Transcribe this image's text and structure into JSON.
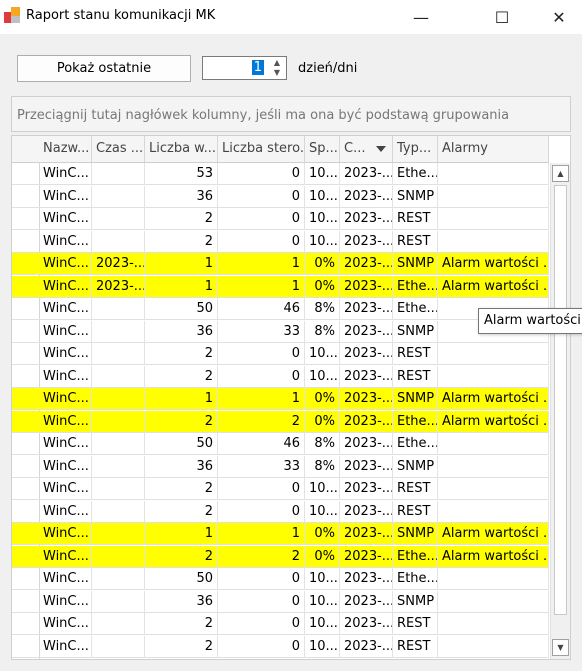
{
  "window": {
    "title": "Raport stanu komunikacji MK",
    "minimize_glyph": "—",
    "maximize_glyph": "☐",
    "close_glyph": "✕"
  },
  "toolbar": {
    "show_button_label": "Pokaż ostatnie",
    "days_value": "1",
    "days_label": "dzień/dni"
  },
  "group_panel": {
    "hint": "Przeciągnij tutaj nagłówek kolumny, jeśli ma ona być podstawą grupowania"
  },
  "grid": {
    "columns": [
      "Nazw...",
      "Czas ...",
      "Liczba w...",
      "Liczba stero...",
      "Sp...",
      "C...",
      "Typ...",
      "Alarmy"
    ],
    "sorted_column": "C...",
    "highlight_color": "#ffff00",
    "rows": [
      {
        "c": [
          "WinC...",
          "",
          "53",
          "0",
          "10...",
          "2023-...",
          "Ethe...",
          ""
        ],
        "hl": false
      },
      {
        "c": [
          "WinC...",
          "",
          "36",
          "0",
          "10...",
          "2023-...",
          "SNMP",
          ""
        ],
        "hl": false
      },
      {
        "c": [
          "WinC...",
          "",
          "2",
          "0",
          "10...",
          "2023-...",
          "REST",
          ""
        ],
        "hl": false
      },
      {
        "c": [
          "WinC...",
          "",
          "2",
          "0",
          "10...",
          "2023-...",
          "REST",
          ""
        ],
        "hl": false
      },
      {
        "c": [
          "WinC...",
          "2023-...",
          "1",
          "1",
          "0%",
          "2023-...",
          "SNMP",
          "Alarm wartości ..."
        ],
        "hl": true
      },
      {
        "c": [
          "WinC...",
          "2023-...",
          "1",
          "1",
          "0%",
          "2023-...",
          "Ethe...",
          "Alarm wartości ..."
        ],
        "hl": true
      },
      {
        "c": [
          "WinC...",
          "",
          "50",
          "46",
          "8%",
          "2023-...",
          "Ethe...",
          ""
        ],
        "hl": false
      },
      {
        "c": [
          "WinC...",
          "",
          "36",
          "33",
          "8%",
          "2023-...",
          "SNMP",
          ""
        ],
        "hl": false
      },
      {
        "c": [
          "WinC...",
          "",
          "2",
          "0",
          "10...",
          "2023-...",
          "REST",
          ""
        ],
        "hl": false
      },
      {
        "c": [
          "WinC...",
          "",
          "2",
          "0",
          "10...",
          "2023-...",
          "REST",
          ""
        ],
        "hl": false
      },
      {
        "c": [
          "WinC...",
          "",
          "1",
          "1",
          "0%",
          "2023-...",
          "SNMP",
          "Alarm wartości ..."
        ],
        "hl": true
      },
      {
        "c": [
          "WinC...",
          "",
          "2",
          "2",
          "0%",
          "2023-...",
          "Ethe...",
          "Alarm wartości ..."
        ],
        "hl": true
      },
      {
        "c": [
          "WinC...",
          "",
          "50",
          "46",
          "8%",
          "2023-...",
          "Ethe...",
          ""
        ],
        "hl": false
      },
      {
        "c": [
          "WinC...",
          "",
          "36",
          "33",
          "8%",
          "2023-...",
          "SNMP",
          ""
        ],
        "hl": false
      },
      {
        "c": [
          "WinC...",
          "",
          "2",
          "0",
          "10...",
          "2023-...",
          "REST",
          ""
        ],
        "hl": false
      },
      {
        "c": [
          "WinC...",
          "",
          "2",
          "0",
          "10...",
          "2023-...",
          "REST",
          ""
        ],
        "hl": false
      },
      {
        "c": [
          "WinC...",
          "",
          "1",
          "1",
          "0%",
          "2023-...",
          "SNMP",
          "Alarm wartości ..."
        ],
        "hl": true
      },
      {
        "c": [
          "WinC...",
          "",
          "2",
          "2",
          "0%",
          "2023-...",
          "Ethe...",
          "Alarm wartości ..."
        ],
        "hl": true
      },
      {
        "c": [
          "WinC...",
          "",
          "50",
          "0",
          "10...",
          "2023-...",
          "Ethe...",
          ""
        ],
        "hl": false
      },
      {
        "c": [
          "WinC...",
          "",
          "36",
          "0",
          "10...",
          "2023-...",
          "SNMP",
          ""
        ],
        "hl": false
      },
      {
        "c": [
          "WinC...",
          "",
          "2",
          "0",
          "10...",
          "2023-...",
          "REST",
          ""
        ],
        "hl": false
      },
      {
        "c": [
          "WinC...",
          "",
          "2",
          "0",
          "10...",
          "2023-...",
          "REST",
          ""
        ],
        "hl": false
      }
    ]
  },
  "tooltip": {
    "text": "Alarm wartości sp"
  }
}
